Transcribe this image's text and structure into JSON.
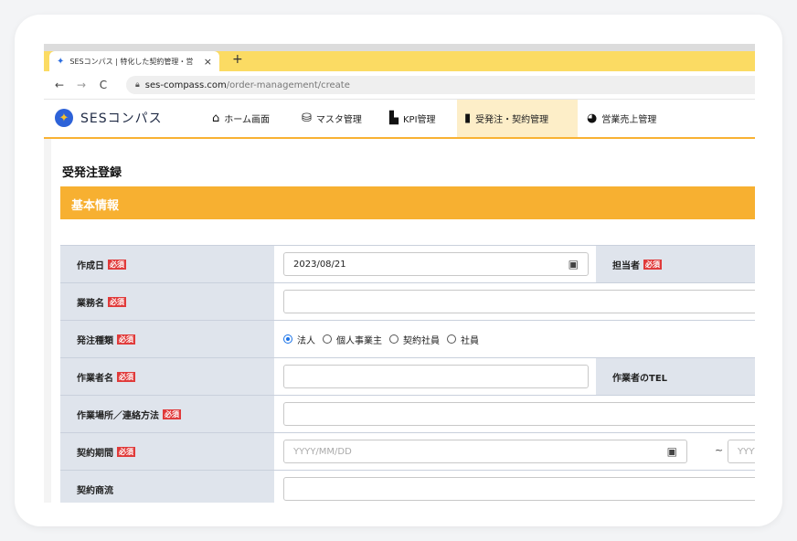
{
  "browser": {
    "tab_title": "SESコンパス | 特化した契約管理・営",
    "tab_close": "×",
    "new_tab": "+",
    "url_domain": "ses-compass.com",
    "url_path": "/order-management/create",
    "back": "←",
    "forward": "→",
    "reload": "C"
  },
  "app": {
    "logo_text": "SESコンパス",
    "nav": [
      {
        "label": "ホーム画面",
        "icon": "home-icon"
      },
      {
        "label": "マスタ管理",
        "icon": "database-icon"
      },
      {
        "label": "KPI管理",
        "icon": "bar-chart-icon"
      },
      {
        "label": "受発注・契約管理",
        "icon": "document-icon",
        "active": true
      },
      {
        "label": "営業売上管理",
        "icon": "pie-chart-icon"
      }
    ]
  },
  "page": {
    "title": "受発注登録",
    "section": "基本情報",
    "required": "必須"
  },
  "form": {
    "created_date_label": "作成日",
    "created_date_value": "2023/08/21",
    "person_in_charge_label": "担当者",
    "business_name_label": "業務名",
    "order_type_label": "発注種類",
    "order_types": [
      "法人",
      "個人事業主",
      "契約社員",
      "社員"
    ],
    "order_type_selected": "法人",
    "worker_name_label": "作業者名",
    "worker_tel_label": "作業者のTEL",
    "work_place_label": "作業場所／連絡方法",
    "contract_period_label": "契約期間",
    "date_placeholder": "YYYY/MM/DD",
    "date_placeholder_short": "YYYY/M",
    "range_separator": "~",
    "contract_flow_label": "契約商流"
  }
}
